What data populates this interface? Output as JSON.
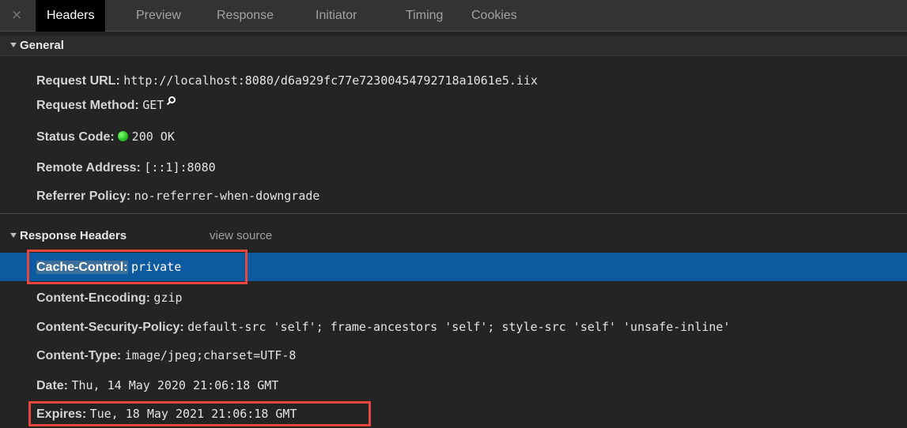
{
  "tabs": {
    "close_glyph": "×",
    "items": [
      {
        "label": "Headers",
        "active": true
      },
      {
        "label": "Preview",
        "active": false
      },
      {
        "label": "Response",
        "active": false
      },
      {
        "label": "Initiator",
        "active": false
      },
      {
        "label": "Timing",
        "active": false
      },
      {
        "label": "Cookies",
        "active": false
      }
    ]
  },
  "general": {
    "title": "General",
    "rows": [
      {
        "name": "Request URL:",
        "value": "http://localhost:8080/d6a929fc77e72300454792718a1061e5.iix"
      },
      {
        "name": "Request Method:",
        "value": "GET"
      },
      {
        "name": "Status Code:",
        "value": "200 OK",
        "status_color": "#2ec42a"
      },
      {
        "name": "Remote Address:",
        "value": "[::1]:8080"
      },
      {
        "name": "Referrer Policy:",
        "value": "no-referrer-when-downgrade"
      }
    ]
  },
  "response_headers": {
    "title": "Response Headers",
    "view_source": "view source",
    "rows": [
      {
        "name": "Cache-Control:",
        "value": "private",
        "selected": true,
        "annotated": true
      },
      {
        "name": "Content-Encoding:",
        "value": "gzip"
      },
      {
        "name": "Content-Security-Policy:",
        "value": "default-src 'self'; frame-ancestors 'self'; style-src 'self' 'unsafe-inline'"
      },
      {
        "name": "Content-Type:",
        "value": "image/jpeg;charset=UTF-8"
      },
      {
        "name": "Date:",
        "value": "Thu, 14 May 2020 21:06:18 GMT"
      },
      {
        "name": "Expires:",
        "value": "Tue, 18 May 2021 21:06:18 GMT",
        "annotated": true
      }
    ]
  },
  "colors": {
    "background": "#242424",
    "selected_row": "#0e5aa0",
    "annotation_box": "#e8473f",
    "status_ok": "#2ec42a"
  },
  "icons": [
    "close-icon",
    "disclosure-triangle-icon",
    "status-dot-icon",
    "magnifier-icon"
  ]
}
